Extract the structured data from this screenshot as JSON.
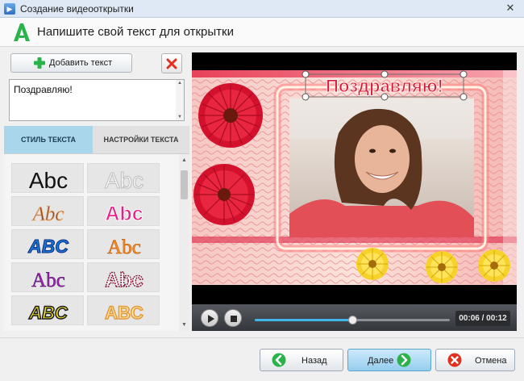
{
  "window": {
    "title": "Создание видеооткрытки",
    "close_glyph": "✕",
    "icon": "app-film-icon"
  },
  "header": {
    "title": "Напишите свой текст для открытки",
    "logo_letter": "A"
  },
  "left_panel": {
    "add_text_label": "Добавить текст",
    "text_value": "Поздравляю!",
    "tabs": [
      {
        "label": "СТИЛЬ ТЕКСТА",
        "active": true
      },
      {
        "label": "НАСТРОЙКИ ТЕКСТА",
        "active": false
      }
    ],
    "style_samples": [
      {
        "text": "Abc",
        "fill": "#ffffff",
        "stroke": "#111111",
        "style": "plain"
      },
      {
        "text": "Abc",
        "fill": "#f5f5f5",
        "stroke": "#c4c4c4",
        "style": "outline-light"
      },
      {
        "text": "Abc",
        "fill": "#8b4a2a",
        "stroke": "#e7b07c",
        "style": "gothic-brown"
      },
      {
        "text": "Abc",
        "fill": "#ec1f86",
        "stroke": "#ffffff",
        "style": "bubble-pink"
      },
      {
        "text": "ABC",
        "fill": "#1976d2",
        "stroke": "#0b2e82",
        "style": "bold-blue"
      },
      {
        "text": "Abc",
        "fill": "#f7931e",
        "stroke": "#c2540a",
        "style": "orange"
      },
      {
        "text": "Abc",
        "fill": "#9c27b0",
        "stroke": "#4a0c66",
        "style": "purple"
      },
      {
        "text": "Abc",
        "fill": "#ffffff",
        "stroke": "#8a1a3a",
        "style": "dotted-outline"
      },
      {
        "text": "ABC",
        "fill": "#f2e32e",
        "stroke": "#1a1a1a",
        "style": "yellow-black"
      },
      {
        "text": "ABC",
        "fill": "#ffe7a8",
        "stroke": "#e39b3a",
        "style": "cream-gold"
      }
    ]
  },
  "preview": {
    "card_caption": "Поздравляю!",
    "caption_color": "#d81b3c"
  },
  "player": {
    "time": "00:06 / 00:12",
    "progress": 0.5
  },
  "footer": {
    "back_label": "Назад",
    "next_label": "Далее",
    "cancel_label": "Отмена"
  },
  "colors": {
    "accent_green": "#2bb34a",
    "tab_active": "#a9d6ea",
    "progress_blue": "#3fb5e8",
    "delete_red": "#e0301e"
  }
}
